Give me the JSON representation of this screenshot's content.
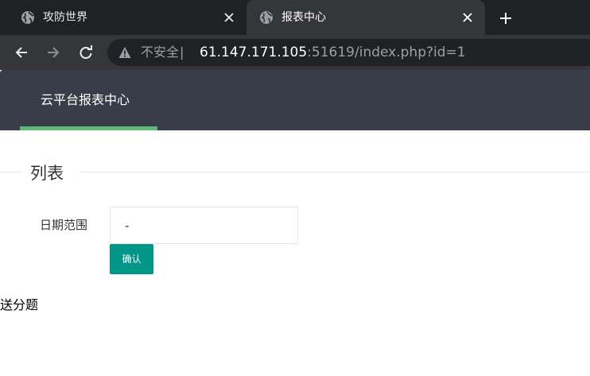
{
  "browser": {
    "tabs": [
      {
        "title": "攻防世界",
        "active": false
      },
      {
        "title": "报表中心",
        "active": true
      }
    ],
    "address_bar": {
      "security_label": "不安全",
      "separator": "|",
      "url_host": "61.147.171.105",
      "url_rest": ":51619/index.php?id=1"
    },
    "icons": {
      "tab_favicon": "globe-icon",
      "tab_close": "close-icon",
      "new_tab": "plus-icon",
      "back": "arrow-left-icon",
      "forward": "arrow-right-icon",
      "reload": "reload-icon",
      "security": "warning-triangle-icon"
    }
  },
  "page": {
    "nav": {
      "items": [
        {
          "label": "云平台报表中心",
          "active": true
        }
      ]
    },
    "section": {
      "legend": "列表"
    },
    "form": {
      "date_label": "日期范围",
      "date_value": "-",
      "confirm_label": "确认"
    },
    "footer_text": "送分题"
  },
  "colors": {
    "tabbar_bg": "#202124",
    "toolbar_bg": "#35363a",
    "appbar_bg": "#393d49",
    "nav_active_underline": "#5fb878",
    "confirm_button": "#009688"
  }
}
